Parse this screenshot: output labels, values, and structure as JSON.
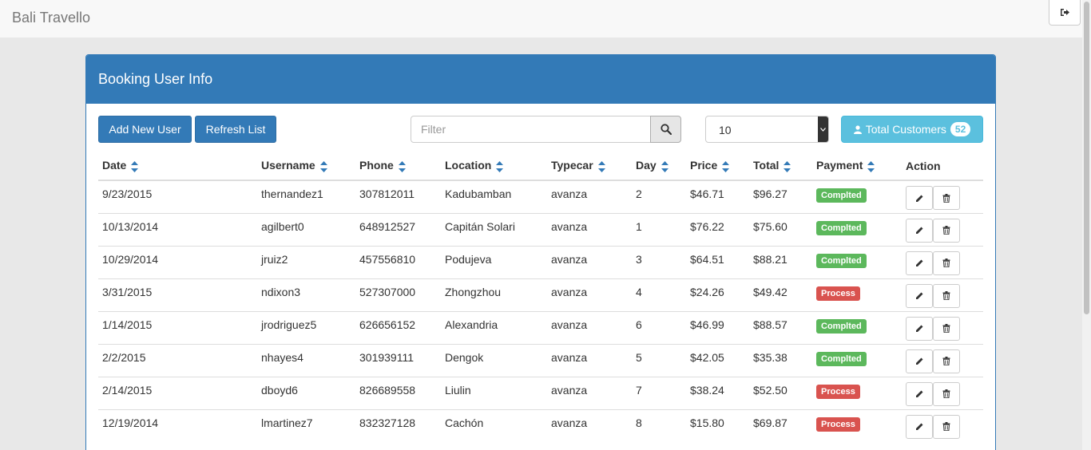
{
  "app": {
    "brand": "Bali Travello"
  },
  "panel": {
    "title": "Booking User Info",
    "add_label": "Add New User",
    "refresh_label": "Refresh List",
    "filter_placeholder": "Filter",
    "page_size": "10",
    "total_label": "Total Customers",
    "total_count": "52"
  },
  "icons": {
    "logout": "sign-out-icon",
    "search": "search-icon",
    "user": "user-icon",
    "sort": "sort-icon",
    "edit": "pencil-icon",
    "delete": "trash-icon"
  },
  "colors": {
    "primary": "#337ab7",
    "info": "#5bc0de",
    "success": "#5cb85c",
    "danger": "#d9534f"
  },
  "table": {
    "headers": [
      "Date",
      "Username",
      "Phone",
      "Location",
      "Typecar",
      "Day",
      "Price",
      "Total",
      "Payment",
      "Action"
    ],
    "rows": [
      {
        "date": "9/23/2015",
        "username": "thernandez1",
        "phone": "307812011",
        "location": "Kadubamban",
        "typecar": "avanza",
        "day": "2",
        "price": "$46.71",
        "total": "$96.27",
        "payment": "Complted",
        "status": "ok"
      },
      {
        "date": "10/13/2014",
        "username": "agilbert0",
        "phone": "648912527",
        "location": "Capitán Solari",
        "typecar": "avanza",
        "day": "1",
        "price": "$76.22",
        "total": "$75.60",
        "payment": "Complted",
        "status": "ok"
      },
      {
        "date": "10/29/2014",
        "username": "jruiz2",
        "phone": "457556810",
        "location": "Podujeva",
        "typecar": "avanza",
        "day": "3",
        "price": "$64.51",
        "total": "$88.21",
        "payment": "Complted",
        "status": "ok"
      },
      {
        "date": "3/31/2015",
        "username": "ndixon3",
        "phone": "527307000",
        "location": "Zhongzhou",
        "typecar": "avanza",
        "day": "4",
        "price": "$24.26",
        "total": "$49.42",
        "payment": "Process",
        "status": "proc"
      },
      {
        "date": "1/14/2015",
        "username": "jrodriguez5",
        "phone": "626656152",
        "location": "Alexandria",
        "typecar": "avanza",
        "day": "6",
        "price": "$46.99",
        "total": "$88.57",
        "payment": "Complted",
        "status": "ok"
      },
      {
        "date": "2/2/2015",
        "username": "nhayes4",
        "phone": "301939111",
        "location": "Dengok",
        "typecar": "avanza",
        "day": "5",
        "price": "$42.05",
        "total": "$35.38",
        "payment": "Complted",
        "status": "ok"
      },
      {
        "date": "2/14/2015",
        "username": "dboyd6",
        "phone": "826689558",
        "location": "Liulin",
        "typecar": "avanza",
        "day": "7",
        "price": "$38.24",
        "total": "$52.50",
        "payment": "Process",
        "status": "proc"
      },
      {
        "date": "12/19/2014",
        "username": "lmartinez7",
        "phone": "832327128",
        "location": "Cachón",
        "typecar": "avanza",
        "day": "8",
        "price": "$15.80",
        "total": "$69.87",
        "payment": "Process",
        "status": "proc"
      }
    ]
  }
}
